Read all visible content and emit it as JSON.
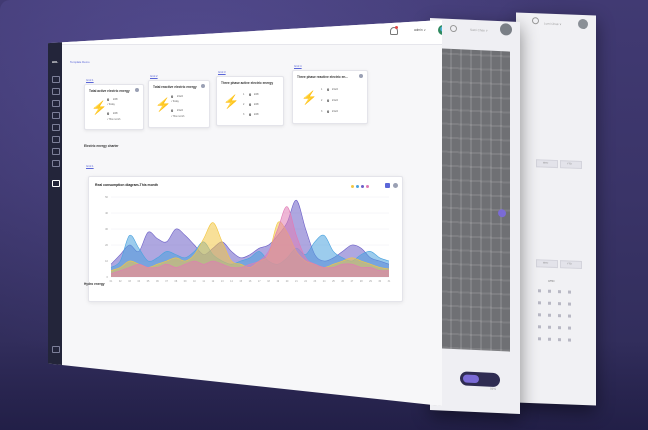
{
  "sidebar": {
    "logo": "HOL"
  },
  "header": {
    "breadcrumb": "Template Demo",
    "user": "admin ∨"
  },
  "cards": [
    {
      "link": "Grid 1",
      "title": "Total active electric energy",
      "values": [
        {
          "num": "0",
          "unit": "kWh",
          "sub": "• Today"
        },
        {
          "num": "0",
          "unit": "kWh",
          "sub": "• This month"
        }
      ]
    },
    {
      "link": "Grid 2",
      "title": "Total reactive electric energy",
      "values": [
        {
          "num": "0",
          "unit": "kVarh",
          "sub": "• Today"
        },
        {
          "num": "0",
          "unit": "kVarh",
          "sub": "• This month"
        }
      ]
    },
    {
      "link": "Grid 3",
      "title": "Three phase active electric energy",
      "values": [
        {
          "num": "0",
          "unit": "kWh",
          "sub": "1"
        },
        {
          "num": "0",
          "unit": "kWh",
          "sub": "2"
        },
        {
          "num": "0",
          "unit": "kWh",
          "sub": "3"
        }
      ]
    },
    {
      "link": "Grid 4",
      "title": "Three phase reactive electric en...",
      "values": [
        {
          "num": "0",
          "unit": "kVarh",
          "sub": "1"
        },
        {
          "num": "0",
          "unit": "kVarh",
          "sub": "2"
        },
        {
          "num": "0",
          "unit": "kVarh",
          "sub": "3"
        }
      ]
    }
  ],
  "sections": {
    "electric": "Electric energy charter",
    "grid": "Grid 1",
    "hydro": "Hydro energy"
  },
  "chart_data": {
    "type": "area",
    "title": "Real consumption diagram-This month",
    "ylim": [
      0,
      50
    ],
    "yticks": [
      "0",
      "10",
      "20",
      "30",
      "40",
      "50"
    ],
    "x": [
      "01",
      "02",
      "03",
      "04",
      "05",
      "06",
      "07",
      "08",
      "09",
      "10",
      "11",
      "12",
      "13",
      "14",
      "15",
      "16",
      "17",
      "18",
      "19",
      "20",
      "21",
      "22",
      "23",
      "24",
      "25",
      "26",
      "27",
      "28",
      "29",
      "30",
      "31"
    ],
    "series": [
      {
        "color": "#6c5fc7",
        "values": [
          8,
          14,
          20,
          16,
          28,
          24,
          22,
          30,
          26,
          20,
          14,
          18,
          22,
          16,
          12,
          14,
          18,
          20,
          26,
          34,
          48,
          30,
          14,
          10,
          12,
          16,
          20,
          18,
          12,
          10,
          8
        ]
      },
      {
        "color": "#4aa3df",
        "values": [
          6,
          10,
          26,
          18,
          10,
          12,
          16,
          14,
          12,
          16,
          22,
          14,
          10,
          8,
          10,
          12,
          16,
          10,
          8,
          12,
          18,
          14,
          22,
          26,
          16,
          12,
          10,
          14,
          16,
          12,
          10
        ]
      },
      {
        "color": "#f2c744",
        "values": [
          4,
          6,
          10,
          8,
          6,
          8,
          10,
          12,
          10,
          14,
          24,
          34,
          22,
          10,
          8,
          6,
          10,
          14,
          34,
          28,
          16,
          10,
          8,
          6,
          8,
          10,
          12,
          10,
          8,
          6,
          5
        ]
      },
      {
        "color": "#e07bb5",
        "values": [
          2,
          4,
          6,
          8,
          6,
          6,
          8,
          6,
          8,
          10,
          8,
          10,
          8,
          6,
          6,
          8,
          10,
          16,
          30,
          44,
          26,
          12,
          8,
          6,
          6,
          8,
          8,
          6,
          6,
          4,
          4
        ]
      }
    ]
  },
  "back": {
    "user2": "Sumi Chae ∨",
    "user3": "Lumi Chae ∨",
    "tab1": "MTD",
    "tab2": "YTD",
    "tab3": "MTD",
    "tab4": "YTD",
    "pct": "59%",
    "grid": "GRID"
  }
}
